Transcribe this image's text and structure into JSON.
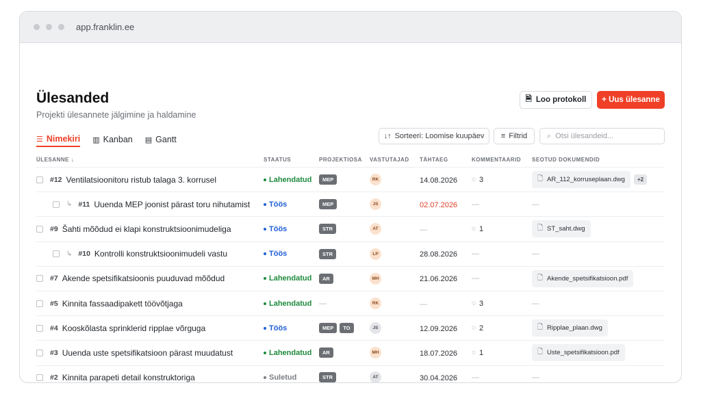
{
  "browser": {
    "url": "app.franklin.ee"
  },
  "header": {
    "title": "Ülesanded",
    "subtitle": "Projekti ülesannete jälgimine ja haldamine",
    "protocol_button": "Loo protokoll",
    "new_button": "+ Uus ülesanne"
  },
  "tabs": [
    {
      "label": "Nimekiri",
      "icon": "list-icon",
      "glyph": "☰"
    },
    {
      "label": "Kanban",
      "icon": "kanban-icon",
      "glyph": "▥"
    },
    {
      "label": "Gantt",
      "icon": "gantt-icon",
      "glyph": "▤"
    }
  ],
  "controls": {
    "sort_label": "Sorteeri: Loomise kuupäev",
    "filter_label": "Filtrid",
    "search_placeholder": "Otsi ülesandeid..."
  },
  "columns": [
    "ÜLESANNE ↓",
    "STAATUS",
    "PROJEKTIOSA",
    "VASTUTAJAD",
    "TÄHTAEG",
    "KOMMENTAARID",
    "SEOTUD DOKUMENDID"
  ],
  "rows": [
    {
      "num": "#12",
      "title": "Ventilatsioonitoru ristub talaga 3. korrusel",
      "sub": false,
      "status": "Lahendatud",
      "status_kind": "green",
      "tags": [
        "MEP"
      ],
      "assignee": "RK",
      "avatar_kind": "orange",
      "due": "14.08.2026",
      "overdue": false,
      "comments": "3",
      "doc": "AR_112_korruseplaan.dwg",
      "more": "+2"
    },
    {
      "num": "#11",
      "title": "Uuenda MEP joonist pärast toru nihutamist",
      "sub": true,
      "status": "Töös",
      "status_kind": "blue",
      "tags": [
        "MEP"
      ],
      "assignee": "JS",
      "avatar_kind": "orange",
      "due": "02.07.2026",
      "overdue": true,
      "comments": "",
      "doc": "",
      "more": ""
    },
    {
      "num": "#9",
      "title": "Šahti mõõdud ei klapi konstruktsioonimudeliga",
      "sub": false,
      "status": "Töös",
      "status_kind": "blue",
      "tags": [
        "STR"
      ],
      "assignee": "AT",
      "avatar_kind": "orange",
      "due": "",
      "overdue": false,
      "comments": "1",
      "doc": "ST_saht.dwg",
      "more": ""
    },
    {
      "num": "#10",
      "title": "Kontrolli konstruktsioonimudeli vastu",
      "sub": true,
      "status": "Töös",
      "status_kind": "blue",
      "tags": [
        "STR"
      ],
      "assignee": "LP",
      "avatar_kind": "orange",
      "due": "28.08.2026",
      "overdue": false,
      "comments": "",
      "doc": "",
      "more": ""
    },
    {
      "num": "#7",
      "title": "Akende spetsifikatsioonis puuduvad mõõdud",
      "sub": false,
      "status": "Lahendatud",
      "status_kind": "green",
      "tags": [
        "AR"
      ],
      "assignee": "MH",
      "avatar_kind": "orange",
      "due": "21.06.2026",
      "overdue": false,
      "comments": "",
      "doc": "Akende_spetsifikatsioon.pdf",
      "more": ""
    },
    {
      "num": "#5",
      "title": "Kinnita fassaadipakett töövõtjaga",
      "sub": false,
      "status": "Lahendatud",
      "status_kind": "green",
      "tags": [],
      "assignee": "RK",
      "avatar_kind": "orange",
      "due": "",
      "overdue": false,
      "comments": "3",
      "doc": "",
      "more": ""
    },
    {
      "num": "#4",
      "title": "Kooskõlasta sprinklerid ripplae võrguga",
      "sub": false,
      "status": "Töös",
      "status_kind": "blue",
      "tags": [
        "MEP",
        "TO"
      ],
      "assignee": "JS",
      "avatar_kind": "gray",
      "due": "12.09.2026",
      "overdue": false,
      "comments": "2",
      "doc": "Ripplae_plaan.dwg",
      "more": ""
    },
    {
      "num": "#3",
      "title": "Uuenda uste spetsifikatsioon pärast muudatust",
      "sub": false,
      "status": "Lahendatud",
      "status_kind": "green",
      "tags": [
        "AR"
      ],
      "assignee": "MH",
      "avatar_kind": "orange",
      "due": "18.07.2026",
      "overdue": false,
      "comments": "1",
      "doc": "Uste_spetsifikatsioon.pdf",
      "more": ""
    },
    {
      "num": "#2",
      "title": "Kinnita parapeti detail konstruktoriga",
      "sub": false,
      "status": "Suletud",
      "status_kind": "gray",
      "tags": [
        "STR"
      ],
      "assignee": "AT",
      "avatar_kind": "gray",
      "due": "30.04.2026",
      "overdue": false,
      "comments": "",
      "doc": "",
      "more": ""
    }
  ],
  "empty_value": "—",
  "colors": {
    "accent": "#ef3f26",
    "resolved": "#1e8a3c",
    "in_progress": "#1f5fd6",
    "closed": "#7a7d82",
    "overdue": "#e0402a"
  }
}
